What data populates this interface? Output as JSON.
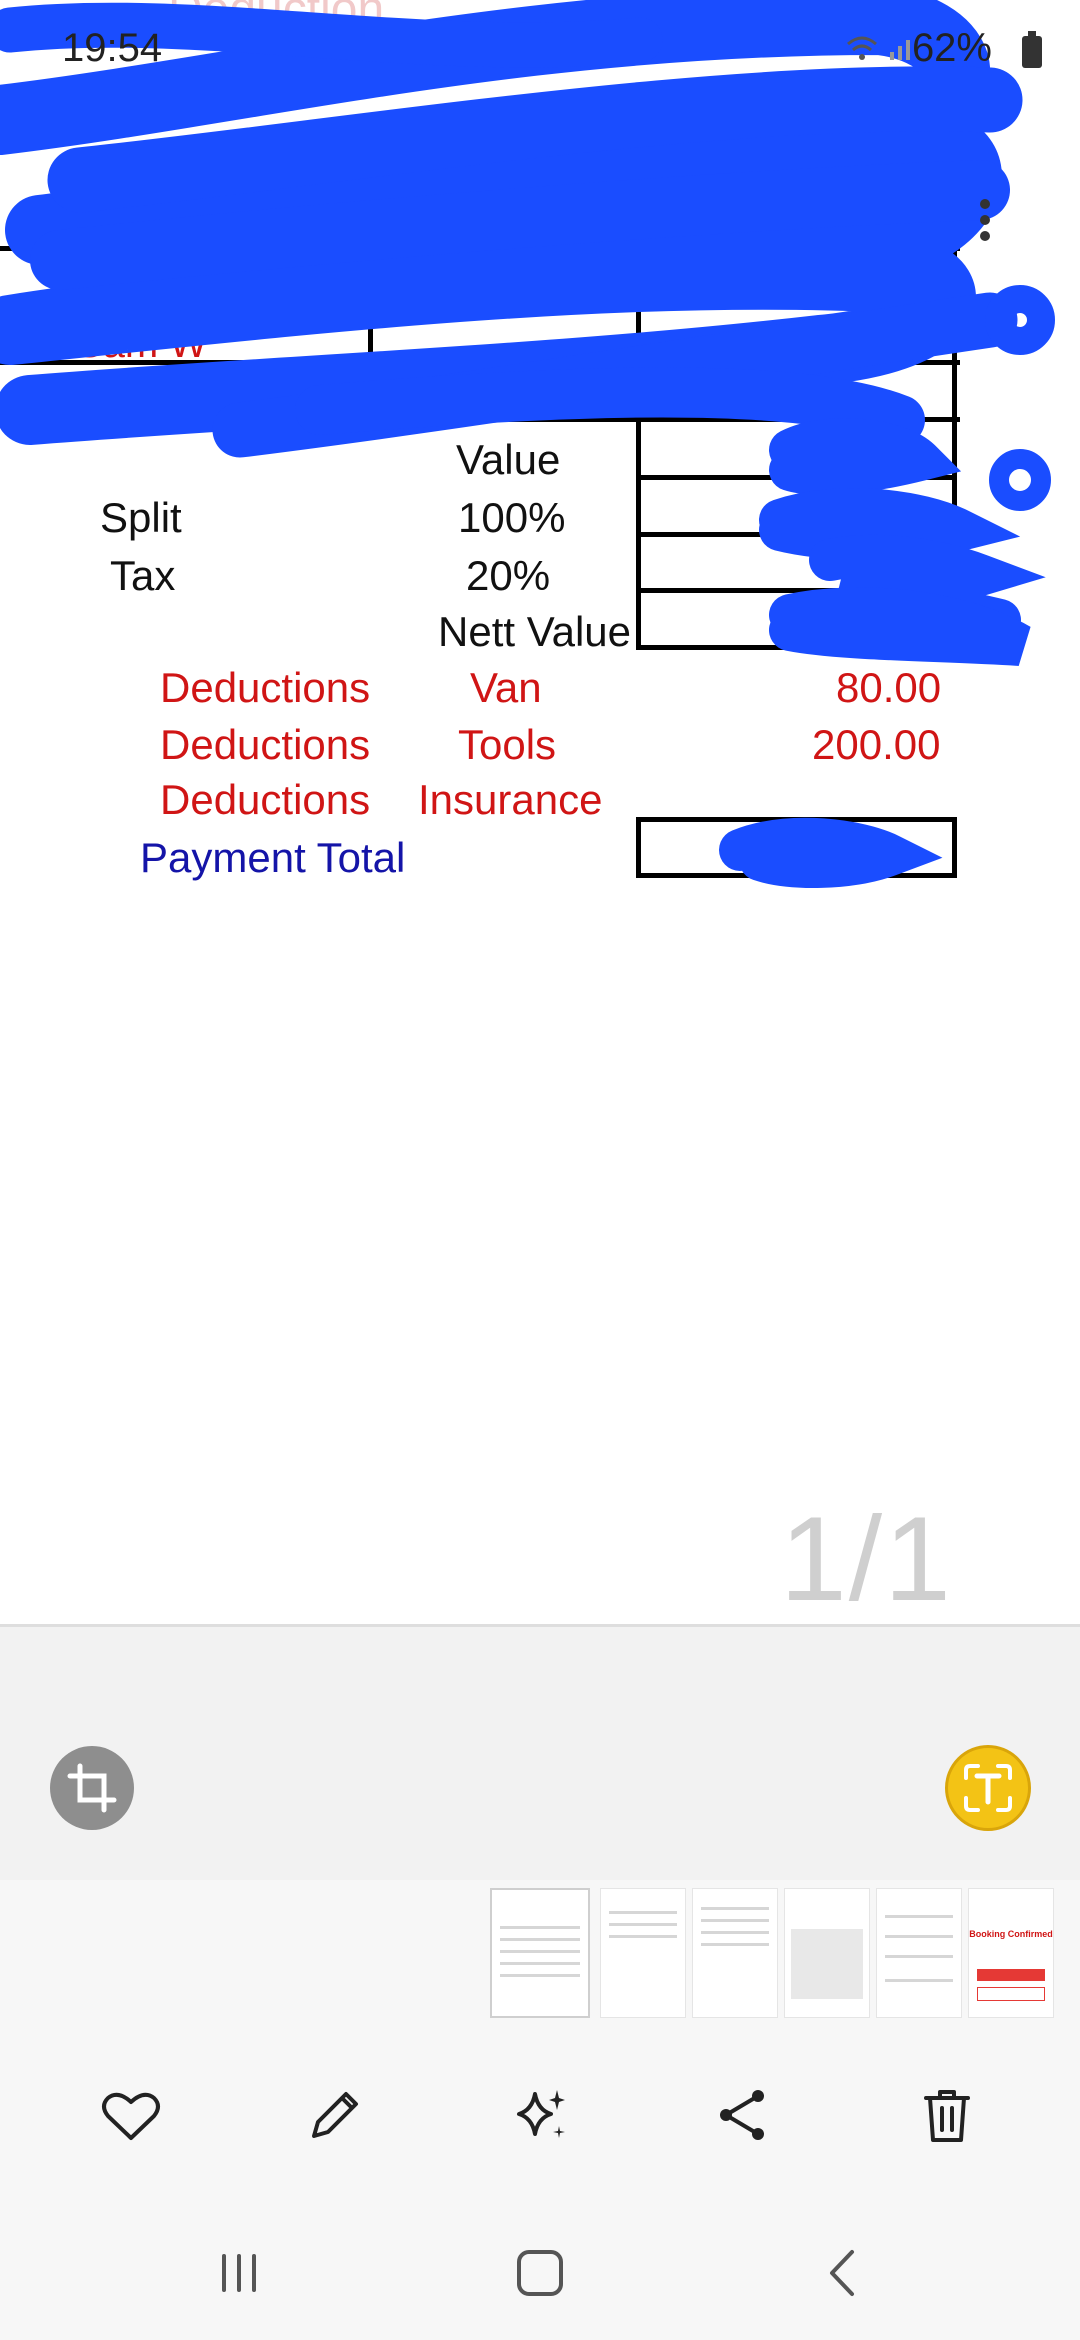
{
  "status_bar": {
    "time": "19:54",
    "battery": "62%"
  },
  "document": {
    "faint_header": "Deduction",
    "name_partial": "Sam W",
    "rows": [
      {
        "label": "",
        "middle": "Value",
        "value": ""
      },
      {
        "label": "Split",
        "middle": "100%",
        "value": ""
      },
      {
        "label": "Tax",
        "middle": "20%",
        "value": ""
      },
      {
        "label": "",
        "middle": "Nett Value",
        "value": ""
      }
    ],
    "deductions": [
      {
        "label": "Deductions",
        "item": "Van",
        "amount": "80.00"
      },
      {
        "label": "Deductions",
        "item": "Tools",
        "amount": "200.00"
      },
      {
        "label": "Deductions",
        "item": "Insurance",
        "amount": ""
      }
    ],
    "payment_total_label": "Payment Total"
  },
  "viewer": {
    "page_indicator": "1/1"
  },
  "thumbnails": {
    "booking_title": "Booking Confirmed"
  },
  "colors": {
    "scribble": "#1a4dff",
    "deduction_red": "#d01515",
    "payment_blue": "#1414a8",
    "text_scan_yellow": "#f3c315"
  },
  "icons": [
    "wifi-icon",
    "signal-icon",
    "battery-icon",
    "crop-icon",
    "text-scan-icon",
    "heart-icon",
    "pencil-icon",
    "sparkles-icon",
    "share-icon",
    "trash-icon",
    "recents-icon",
    "home-icon",
    "back-icon",
    "more-icon",
    "rotate-icon"
  ]
}
